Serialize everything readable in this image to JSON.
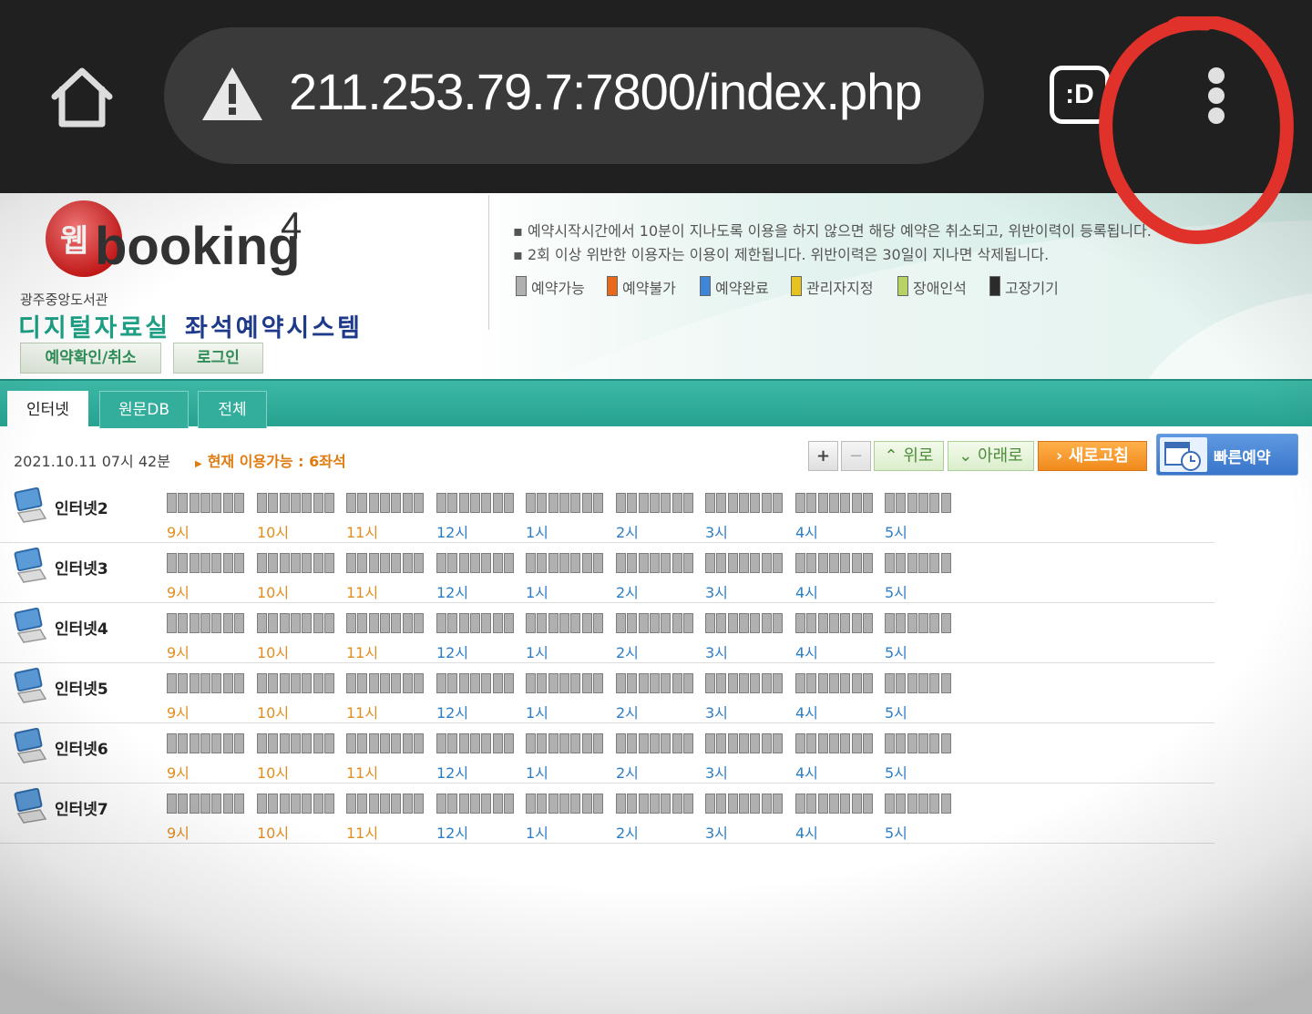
{
  "browser": {
    "url": "211.253.79.7:7800/index.php",
    "tab_switcher_label": ":D"
  },
  "header": {
    "logo_text": "웹booking4",
    "library_name": "광주중앙도서관",
    "title_part1": "디지털자료실",
    "title_part2": "좌석예약시스템",
    "btn_confirm": "예약확인/취소",
    "btn_login": "로그인"
  },
  "notices": [
    "예약시작시간에서 10분이 지나도록 이용을 하지 않으면 해당 예약은 취소되고, 위반이력이 등록됩니다.",
    "2회 이상 위반한 이용자는 이용이 제한됩니다. 위반이력은 30일이 지나면 삭제됩니다."
  ],
  "legend": [
    {
      "label": "예약가능",
      "color": "#b0b0b0"
    },
    {
      "label": "예약불가",
      "color": "#e8681c"
    },
    {
      "label": "예약완료",
      "color": "#3d86d9"
    },
    {
      "label": "관리자지정",
      "color": "#e6c21c"
    },
    {
      "label": "장애인석",
      "color": "#b8d266"
    },
    {
      "label": "고장기기",
      "color": "#2b2b2b"
    }
  ],
  "tabs": [
    "인터넷",
    "원문DB",
    "전체"
  ],
  "status": {
    "datetime": "2021.10.11 07시 42분",
    "available": "현재 이용가능 : 6좌석"
  },
  "controls": {
    "zoom_in": "+",
    "zoom_out": "−",
    "up": "위로",
    "down": "아래로",
    "refresh": "새로고침",
    "quick": "빠른예약"
  },
  "hours": [
    {
      "label": "9시",
      "period": "am",
      "cells": 7
    },
    {
      "label": "10시",
      "period": "am",
      "cells": 7
    },
    {
      "label": "11시",
      "period": "am",
      "cells": 7
    },
    {
      "label": "12시",
      "period": "pm",
      "cells": 7
    },
    {
      "label": "1시",
      "period": "pm",
      "cells": 7
    },
    {
      "label": "2시",
      "period": "pm",
      "cells": 7
    },
    {
      "label": "3시",
      "period": "pm",
      "cells": 7
    },
    {
      "label": "4시",
      "period": "pm",
      "cells": 7
    },
    {
      "label": "5시",
      "period": "pm",
      "cells": 6
    }
  ],
  "seats": [
    "인터넷2",
    "인터넷3",
    "인터넷4",
    "인터넷5",
    "인터넷6",
    "인터넷7"
  ],
  "colors": {
    "toolbar": "#202020",
    "teal": "#2aa594",
    "annotation": "#e0322a"
  }
}
